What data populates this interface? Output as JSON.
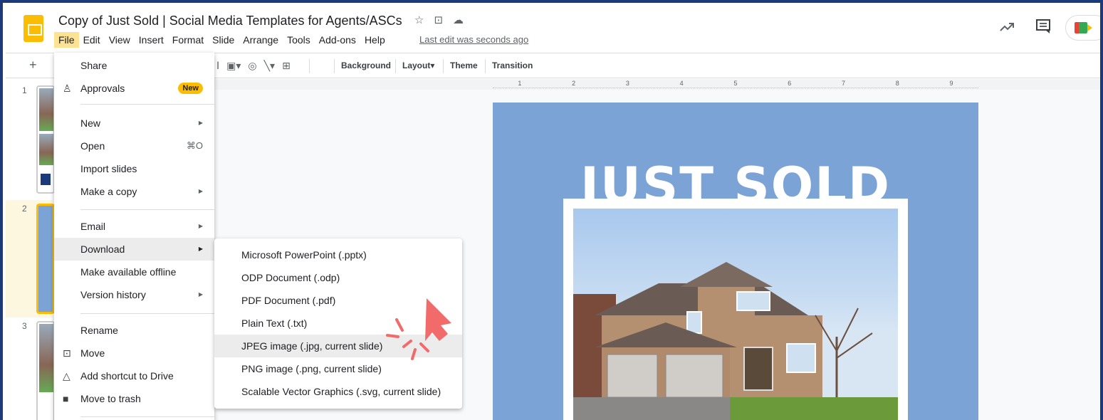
{
  "header": {
    "doc_title": "Copy of Just Sold | Social Media Templates for Agents/ASCs",
    "last_edit": "Last edit was seconds ago",
    "menus": [
      "File",
      "Edit",
      "View",
      "Insert",
      "Format",
      "Slide",
      "Arrange",
      "Tools",
      "Add-ons",
      "Help"
    ]
  },
  "toolbar": {
    "plus": "+",
    "background": "Background",
    "layout": "Layout",
    "theme": "Theme",
    "transition": "Transition"
  },
  "ruler": [
    "1",
    "2",
    "3",
    "4",
    "5",
    "6",
    "7",
    "8",
    "9"
  ],
  "filmstrip": {
    "slide_numbers": [
      "1",
      "2",
      "3"
    ]
  },
  "file_menu": {
    "items": [
      {
        "label": "Share"
      },
      {
        "label": "Approvals",
        "badge": "New"
      },
      {
        "label": "New"
      },
      {
        "label": "Open",
        "shortcut": "⌘O"
      },
      {
        "label": "Import slides"
      },
      {
        "label": "Make a copy"
      },
      {
        "label": "Email"
      },
      {
        "label": "Download"
      },
      {
        "label": "Make available offline"
      },
      {
        "label": "Version history"
      },
      {
        "label": "Rename"
      },
      {
        "label": "Move"
      },
      {
        "label": "Add shortcut to Drive"
      },
      {
        "label": "Move to trash"
      }
    ]
  },
  "download_menu": {
    "items": [
      "Microsoft PowerPoint (.pptx)",
      "ODP Document (.odp)",
      "PDF Document (.pdf)",
      "Plain Text (.txt)",
      "JPEG image (.jpg, current slide)",
      "PNG image (.png, current slide)",
      "Scalable Vector Graphics (.svg, current slide)"
    ]
  },
  "slide": {
    "heading": "JUST SOLD"
  },
  "colors": {
    "accent_yellow": "#fbbc04",
    "menu_highlight": "#fde293",
    "slide_blue": "#7ba3d6",
    "pointer_red": "#f26b6b"
  }
}
